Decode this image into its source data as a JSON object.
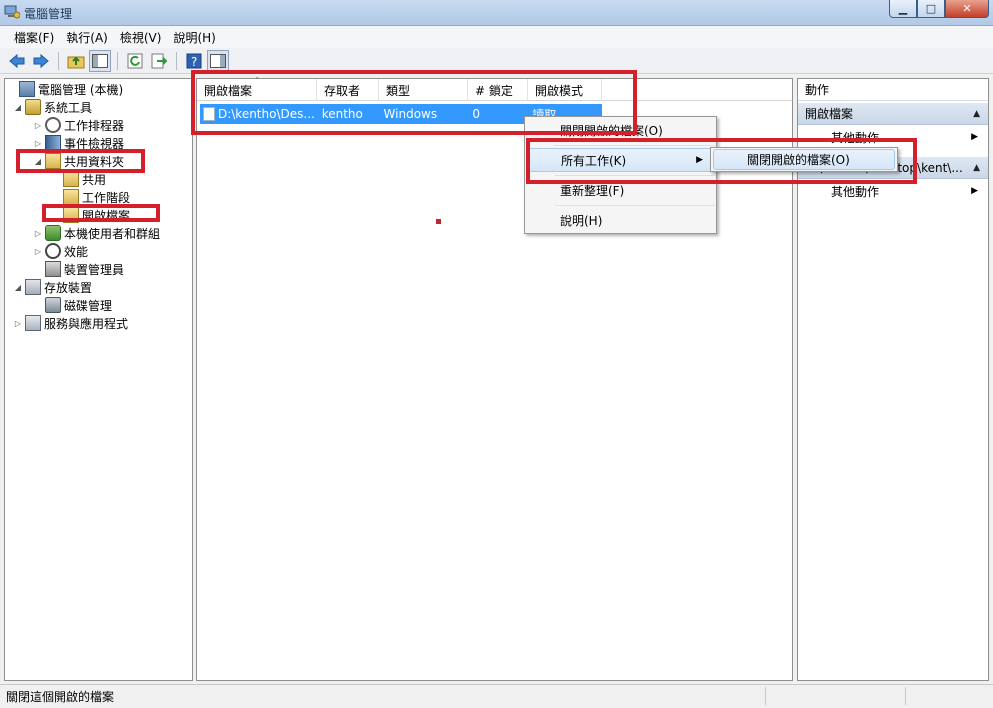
{
  "window": {
    "title": "電腦管理"
  },
  "menu": [
    "檔案(F)",
    "執行(A)",
    "檢視(V)",
    "說明(H)"
  ],
  "tree": [
    {
      "label": "電腦管理 (本機)",
      "icon": "computer-management-icon",
      "arrow": ""
    },
    {
      "label": "系統工具",
      "icon": "tools-icon",
      "arrow": "◢"
    },
    {
      "label": "工作排程器",
      "icon": "clock-icon",
      "arrow": "▷"
    },
    {
      "label": "事件檢視器",
      "icon": "event-viewer-icon",
      "arrow": "▷"
    },
    {
      "label": "共用資料夾",
      "icon": "shared-folder-icon",
      "arrow": "◢"
    },
    {
      "label": "共用",
      "icon": "share-icon",
      "arrow": ""
    },
    {
      "label": "工作階段",
      "icon": "session-icon",
      "arrow": ""
    },
    {
      "label": "開啟檔案",
      "icon": "open-files-icon",
      "arrow": ""
    },
    {
      "label": "本機使用者和群組",
      "icon": "users-icon",
      "arrow": "▷"
    },
    {
      "label": "效能",
      "icon": "performance-icon",
      "arrow": "▷"
    },
    {
      "label": "裝置管理員",
      "icon": "device-manager-icon",
      "arrow": ""
    },
    {
      "label": "存放裝置",
      "icon": "storage-icon",
      "arrow": "◢"
    },
    {
      "label": "磁碟管理",
      "icon": "disk-icon",
      "arrow": ""
    },
    {
      "label": "服務與應用程式",
      "icon": "services-icon",
      "arrow": "▷"
    }
  ],
  "list": {
    "columns": [
      "開啟檔案",
      "存取者",
      "類型",
      "# 鎖定",
      "開啟模式"
    ],
    "rows": [
      {
        "file": "D:\\kentho\\Des...",
        "accessor": "kentho",
        "type": "Windows",
        "locks": "0",
        "mode": "讀取"
      }
    ]
  },
  "actions": {
    "title": "動作",
    "sections": [
      {
        "label": "開啟檔案",
        "item": "其他動作"
      },
      {
        "label": "D:\\kentho\\Desktop\\kent\\...",
        "item": "其他動作"
      }
    ]
  },
  "context_menu": {
    "items": [
      "關閉開啟的檔案(O)",
      "所有工作(K)",
      "重新整理(F)",
      "說明(H)"
    ],
    "submenu": [
      "關閉開啟的檔案(O)"
    ]
  },
  "status": {
    "text": "關閉這個開啟的檔案"
  },
  "colors": {
    "selection": "#3399ff",
    "annotation": "#d4202a",
    "titlebar": "#b1c9e6"
  }
}
